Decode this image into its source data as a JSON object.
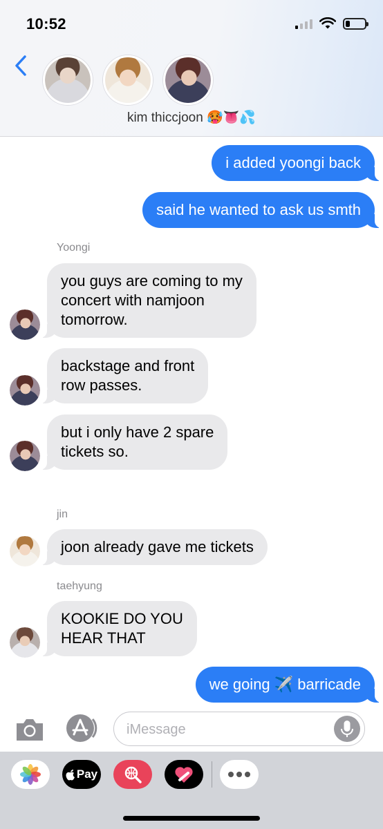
{
  "status_bar": {
    "time": "10:52",
    "battery_level": 0.2
  },
  "header": {
    "group_name": "kim thiccjoon 🥵👅💦",
    "avatars": [
      "member-1-avatar",
      "member-2-avatar",
      "member-3-avatar"
    ]
  },
  "messages": {
    "m1": {
      "text": "i added yoongi back"
    },
    "m2": {
      "text": "said he wanted to ask us smth"
    },
    "yoongi": {
      "sender": "Yoongi",
      "m3": [
        "you guys are coming to my",
        "concert with namjoon",
        "tomorrow."
      ],
      "m4": [
        "backstage and front",
        "row passes."
      ],
      "m5": [
        "but i only have 2 spare",
        "tickets so."
      ]
    },
    "jin": {
      "sender": "jin",
      "m6": "joon already gave me tickets"
    },
    "taehyung": {
      "sender": "taehyung",
      "m7": [
        "KOOKIE DO YOU",
        "HEAR THAT"
      ]
    },
    "m8": {
      "text": "we going ✈️ barricade"
    }
  },
  "input": {
    "placeholder": "iMessage",
    "value": ""
  },
  "drawer": {
    "pay_label": "Pay"
  },
  "colors": {
    "outgoing": "#2b7ef6",
    "incoming": "#e9e9eb",
    "drawer": "#d2d4d9"
  }
}
